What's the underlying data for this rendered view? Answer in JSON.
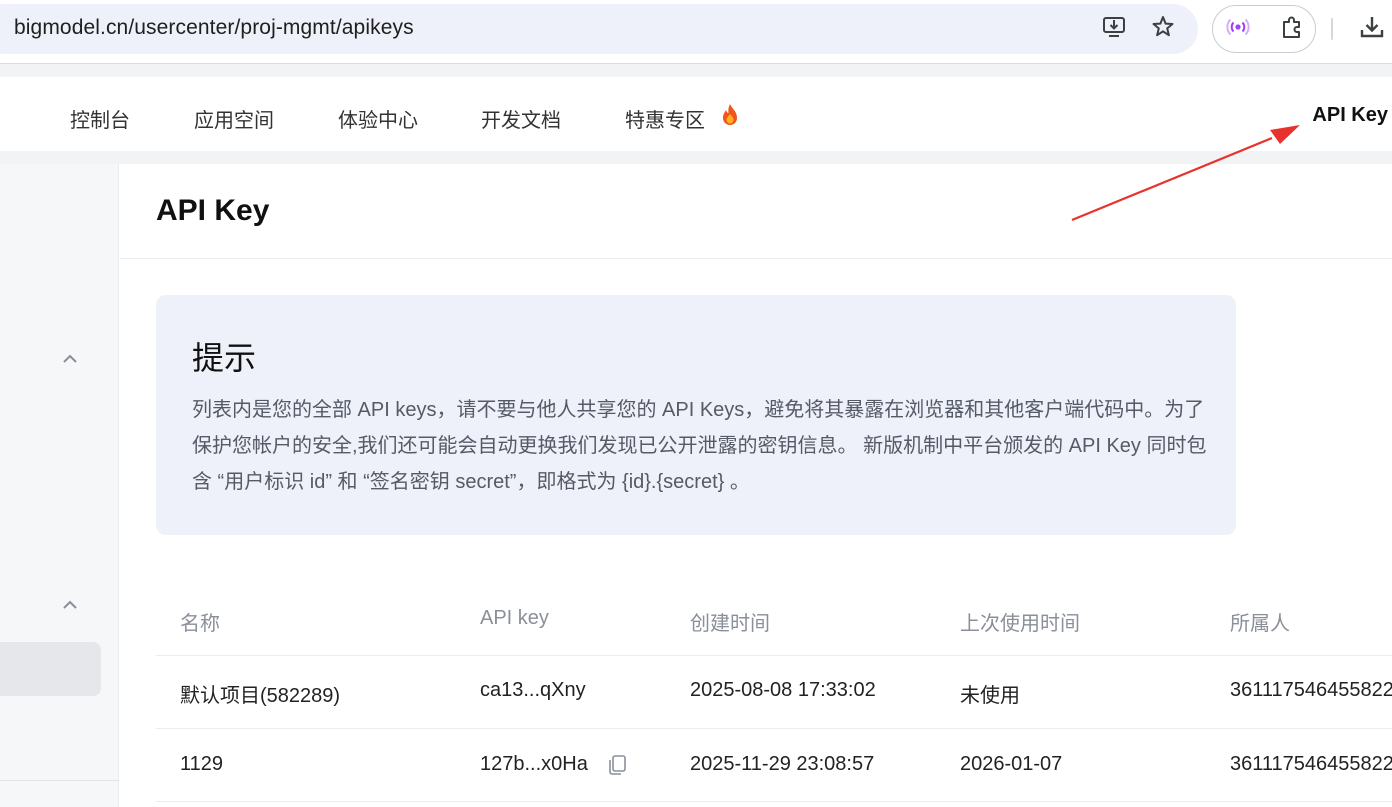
{
  "browser": {
    "url": "bigmodel.cn/usercenter/proj-mgmt/apikeys",
    "icons": [
      "install-app-icon",
      "bookmark-star-icon",
      "broadcast-icon",
      "extensions-icon",
      "download-icon"
    ]
  },
  "nav": {
    "items": [
      {
        "label": "控制台"
      },
      {
        "label": "应用空间"
      },
      {
        "label": "体验中心"
      },
      {
        "label": "开发文档"
      },
      {
        "label": "特惠专区"
      }
    ],
    "right_label": "API Key"
  },
  "page": {
    "title": "API Key"
  },
  "notice": {
    "title": "提示",
    "body": "列表内是您的全部 API keys，请不要与他人共享您的 API Keys，避免将其暴露在浏览器和其他客户端代码中。为了保护您帐户的安全,我们还可能会自动更换我们发现已公开泄露的密钥信息。 新版机制中平台颁发的 API Key 同时包含 “用户标识 id” 和 “签名密钥 secret”，即格式为 {id}.{secret} 。"
  },
  "table": {
    "headers": [
      "名称",
      "API key",
      "创建时间",
      "上次使用时间",
      "所属人"
    ],
    "rows": [
      {
        "name": "默认项目(582289)",
        "key": "ca13...qXny",
        "created": "2025-08-08 17:33:02",
        "last_used": "未使用",
        "owner": "361117546455822"
      },
      {
        "name": "1129",
        "key": "127b...x0Ha",
        "created": "2025-11-29 23:08:57",
        "last_used": "2026-01-07",
        "owner": "361117546455822"
      }
    ]
  },
  "colors": {
    "notice_bg": "#eef1f9",
    "annotation_arrow": "#e8322c"
  }
}
